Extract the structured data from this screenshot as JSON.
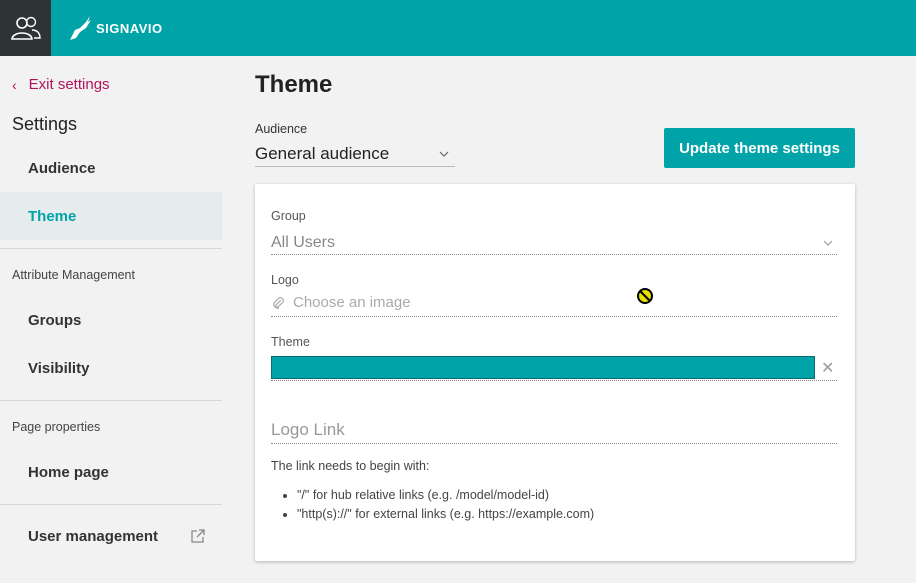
{
  "topbar": {
    "brand": "SIGNAVIO",
    "accent": "#00a3a8"
  },
  "sidebar": {
    "exit_label": "Exit settings",
    "settings_heading": "Settings",
    "items": [
      {
        "label": "Audience"
      },
      {
        "label": "Theme",
        "active": true
      },
      {
        "section": "Attribute Management"
      },
      {
        "label": "Groups"
      },
      {
        "label": "Visibility"
      },
      {
        "section": "Page properties"
      },
      {
        "label": "Home page"
      },
      {
        "label": "User management"
      }
    ]
  },
  "main": {
    "title": "Theme",
    "audience_label": "Audience",
    "audience_value": "General audience",
    "update_button": "Update theme settings"
  },
  "card": {
    "group_label": "Group",
    "group_value": "All Users",
    "logo_label": "Logo",
    "logo_placeholder": "Choose an image",
    "theme_label": "Theme",
    "theme_color": "#00a3a8",
    "logo_link_placeholder": "Logo Link",
    "help_text": "The link needs to begin with:",
    "help_items": [
      "\"/\" for hub relative links (e.g. /model/model-id)",
      "\"http(s)://\" for external links (e.g. https://example.com)"
    ]
  }
}
